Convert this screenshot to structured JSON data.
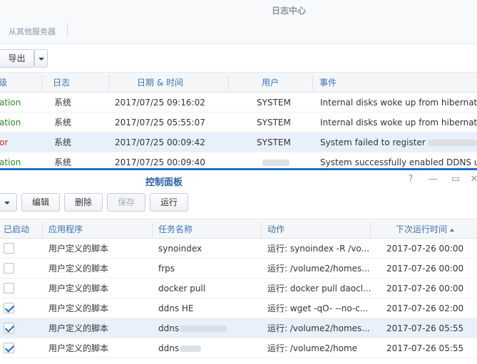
{
  "log_center": {
    "title": "日志中心",
    "from_other_servers": "从其他服务器",
    "toolbar": {
      "export_label": "导出"
    },
    "columns": {
      "level": "级",
      "log": "日志",
      "datetime": "日期 & 时间",
      "user": "用户",
      "event": "事件"
    },
    "rows": [
      {
        "level": "ation",
        "level_type": "info",
        "log": "系统",
        "datetime": "2017/07/25 09:16:02",
        "user": "SYSTEM",
        "event": "Internal disks woke up from hibernat"
      },
      {
        "level": "ation",
        "level_type": "info",
        "log": "系统",
        "datetime": "2017/07/25 05:55:07",
        "user": "SYSTEM",
        "event": "Internal disks woke up from hibernat"
      },
      {
        "level": "or",
        "level_type": "error",
        "log": "系统",
        "datetime": "2017/07/25 00:09:42",
        "user": "SYSTEM",
        "event": "System failed to register"
      },
      {
        "level": "ation",
        "level_type": "info",
        "log": "系统",
        "datetime": "2017/07/25 00:09:40",
        "user": "",
        "event": "System successfully enabled DDNS u"
      }
    ]
  },
  "control_panel": {
    "title": "控制面板",
    "window_controls": {
      "help": "?",
      "minimize": "—",
      "maximize": "▭",
      "close": "✕"
    },
    "toolbar": {
      "edit": "编辑",
      "delete": "删除",
      "save": "保存",
      "run": "运行"
    },
    "columns": {
      "enabled": "已启动",
      "app": "应用程序",
      "task": "任务名称",
      "action": "动作",
      "next_run": "下次运行时间"
    },
    "rows": [
      {
        "enabled": false,
        "app": "用户定义的脚本",
        "task": "synoindex",
        "action": "运行: synoindex -R /vo...",
        "next_run": "2017-07-26 00:00"
      },
      {
        "enabled": false,
        "app": "用户定义的脚本",
        "task": "frps",
        "action": "运行: /volume2/homes...",
        "next_run": "2017-07-26 00:00"
      },
      {
        "enabled": false,
        "app": "用户定义的脚本",
        "task": "docker pull",
        "action": "运行: docker pull daocl...",
        "next_run": "2017-07-26 00:00"
      },
      {
        "enabled": true,
        "app": "用户定义的脚本",
        "task": "ddns HE",
        "action": "运行: wget -qO- --no-c...",
        "next_run": "2017-07-26 02:00"
      },
      {
        "enabled": true,
        "app": "用户定义的脚本",
        "task": "ddns",
        "action": "运行: /volume2/homes...",
        "next_run": "2017-07-26 05:55"
      },
      {
        "enabled": true,
        "app": "用户定义的脚本",
        "task": "ddns",
        "action": "运行: /volume2/home",
        "next_run": "2017-07-26 05:55"
      }
    ]
  },
  "colors": {
    "accent": "#1f6fc1",
    "header_text": "#3b73b4",
    "info": "#2d8a2d",
    "error": "#d0241b",
    "selected_row": "#e8f1fb"
  }
}
